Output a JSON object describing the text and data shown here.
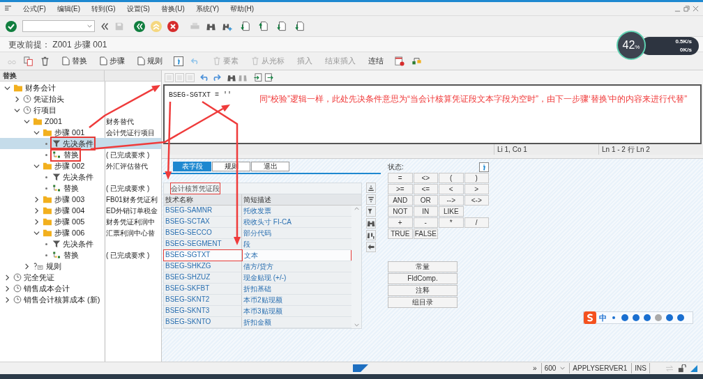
{
  "menu": [
    "公式(F)",
    "编辑(E)",
    "转到(G)",
    "设置(S)",
    "替换(U)",
    "系统(Y)",
    "帮助(H)"
  ],
  "title": "更改前提： Z001 步骤 001",
  "network": {
    "percent": "42",
    "unit": "%",
    "up": "0.5K/s",
    "down": "0K/s"
  },
  "app_toolbar": [
    {
      "kind": "doc",
      "label": "替换",
      "disabled": false
    },
    {
      "kind": "doc",
      "label": "步骤",
      "disabled": false
    },
    {
      "kind": "doc",
      "label": "规则",
      "disabled": false
    },
    {
      "kind": "trash",
      "label": "要素",
      "disabled": true
    },
    {
      "kind": "trash",
      "label": "从光标",
      "disabled": true
    },
    {
      "kind": "plain",
      "label": "插入",
      "disabled": true
    },
    {
      "kind": "plain",
      "label": "结束插入",
      "disabled": true
    },
    {
      "kind": "plain",
      "label": "连结",
      "disabled": false
    }
  ],
  "tree": {
    "header": "替换",
    "items": [
      {
        "kind": "folder",
        "label": "财务会计",
        "expanded": true,
        "children": [
          {
            "kind": "clock",
            "label": "凭证抬头",
            "expanded": false
          },
          {
            "kind": "clock",
            "label": "行项目",
            "expanded": true,
            "children": [
              {
                "kind": "folder",
                "label": "Z001",
                "desc": "财务替代",
                "expanded": true,
                "children": [
                  {
                    "kind": "folder",
                    "label": "步骤 001",
                    "desc": "会计凭证行项目",
                    "expanded": true,
                    "children": [
                      {
                        "kind": "filter",
                        "label": "先决条件",
                        "selected": true,
                        "marked": true
                      },
                      {
                        "kind": "replace",
                        "label": "替换",
                        "desc": "( 已完成要求 )",
                        "selected": false,
                        "marked": true
                      }
                    ]
                  },
                  {
                    "kind": "folder",
                    "label": "步骤 002",
                    "desc": "外汇评估替代",
                    "expanded": true,
                    "children": [
                      {
                        "kind": "filter",
                        "label": "先决条件",
                        "selected": false,
                        "marked": false
                      },
                      {
                        "kind": "replace",
                        "label": "替换",
                        "desc": "( 已完成要求 )",
                        "selected": false,
                        "marked": false
                      }
                    ]
                  },
                  {
                    "kind": "folder",
                    "label": "步骤 003",
                    "desc": "FB01财务凭证利",
                    "expanded": false
                  },
                  {
                    "kind": "folder",
                    "label": "步骤 004",
                    "desc": "ED外销订单税金",
                    "expanded": false
                  },
                  {
                    "kind": "folder",
                    "label": "步骤 005",
                    "desc": "财务凭证利润中",
                    "expanded": false
                  },
                  {
                    "kind": "folder",
                    "label": "步骤 006",
                    "desc": "汇票利润中心替",
                    "expanded": true,
                    "children": [
                      {
                        "kind": "filter",
                        "label": "先决条件",
                        "selected": false,
                        "marked": false
                      },
                      {
                        "kind": "replace",
                        "label": "替换",
                        "desc": "( 已完成要求 )",
                        "selected": false,
                        "marked": false
                      }
                    ]
                  }
                ]
              },
              {
                "kind": "rule",
                "label": "规则",
                "expanded": false
              }
            ]
          }
        ]
      },
      {
        "kind": "clock",
        "label": "完全凭证",
        "expanded": false
      },
      {
        "kind": "clock",
        "label": "销售成本会计",
        "expanded": false
      },
      {
        "kind": "clock",
        "label": "销售会计核算成本 (新)",
        "expanded": false
      }
    ]
  },
  "editor": {
    "code": "BSEG-SGTXT = ''",
    "annotation": "同“校验”逻辑一样，此处先决条件意思为“当会计核算凭证段文本字段为空时”，由下一步骤‘替换’中的内容来进行代替”",
    "position": "Li 1, Co 1",
    "lines": "Ln 1 - 2 行 Ln 2"
  },
  "tabs": [
    {
      "label": "表字段",
      "selected": true
    },
    {
      "label": "规则",
      "selected": false
    },
    {
      "label": "退出",
      "selected": false
    }
  ],
  "field_table": {
    "title": "会计核算凭证段",
    "columns": [
      "技术名称",
      "简短描述"
    ],
    "rows": [
      {
        "name": "BSEG-SAMNR",
        "desc": "托收发票",
        "selected": false
      },
      {
        "name": "BSEG-SCTAX",
        "desc": "税收头寸 FI-CA",
        "selected": false
      },
      {
        "name": "BSEG-SECCO",
        "desc": "部分代码",
        "selected": false
      },
      {
        "name": "BSEG-SEGMENT",
        "desc": "段",
        "selected": false
      },
      {
        "name": "BSEG-SGTXT",
        "desc": "文本",
        "selected": true
      },
      {
        "name": "BSEG-SHKZG",
        "desc": "借方/贷方",
        "selected": false
      },
      {
        "name": "BSEG-SHZUZ",
        "desc": "现金贴现 (+/-)",
        "selected": false
      },
      {
        "name": "BSEG-SKFBT",
        "desc": "折扣基础",
        "selected": false
      },
      {
        "name": "BSEG-SKNT2",
        "desc": "本币2贴现额",
        "selected": false
      },
      {
        "name": "BSEG-SKNT3",
        "desc": "本币3贴现额",
        "selected": false
      },
      {
        "name": "BSEG-SKNTO",
        "desc": "折扣金额",
        "selected": false
      }
    ]
  },
  "operators": {
    "label": "状态:",
    "rows": [
      [
        "=",
        "<>",
        "(",
        ")"
      ],
      [
        ">=",
        "<=",
        "<",
        ">"
      ],
      [
        "AND",
        "OR",
        "-->",
        "<->"
      ],
      [
        "NOT",
        "IN",
        "LIKE"
      ],
      [
        "+",
        "-",
        "*",
        "/"
      ],
      [
        "TRUE",
        "FALSE"
      ]
    ]
  },
  "buttons": [
    "常量",
    "FldComp.",
    "注释",
    "组目录"
  ],
  "ime": {
    "mode": "中"
  },
  "status_bar": {
    "expand": "»",
    "client": "600",
    "server": "APPLYSERVER1",
    "mode": "INS"
  }
}
